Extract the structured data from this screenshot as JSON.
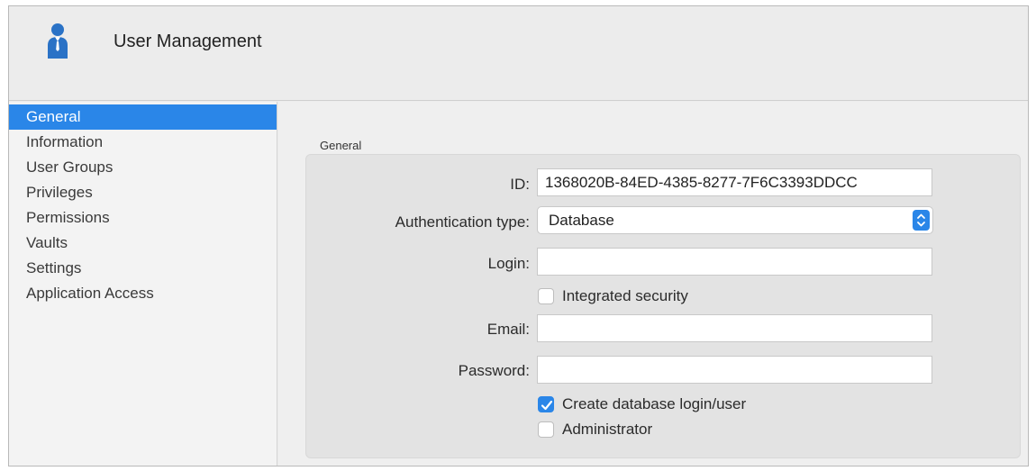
{
  "header": {
    "title": "User Management",
    "icon": "user-icon"
  },
  "sidebar": {
    "items": [
      {
        "label": "General",
        "active": true
      },
      {
        "label": "Information",
        "active": false
      },
      {
        "label": "User Groups",
        "active": false
      },
      {
        "label": "Privileges",
        "active": false
      },
      {
        "label": "Permissions",
        "active": false
      },
      {
        "label": "Vaults",
        "active": false
      },
      {
        "label": "Settings",
        "active": false
      },
      {
        "label": "Application Access",
        "active": false
      }
    ]
  },
  "form": {
    "group_title": "General",
    "id_label": "ID:",
    "id_value": "1368020B-84ED-4385-8277-7F6C3393DDCC",
    "auth_label": "Authentication type:",
    "auth_value": "Database",
    "login_label": "Login:",
    "login_value": "",
    "integrated_label": "Integrated security",
    "integrated_checked": false,
    "email_label": "Email:",
    "email_value": "",
    "password_label": "Password:",
    "password_value": "",
    "create_db_label": "Create database login/user",
    "create_db_checked": true,
    "admin_label": "Administrator",
    "admin_checked": false
  },
  "colors": {
    "accent": "#2a86e8",
    "user_icon": "#2a72c6"
  }
}
